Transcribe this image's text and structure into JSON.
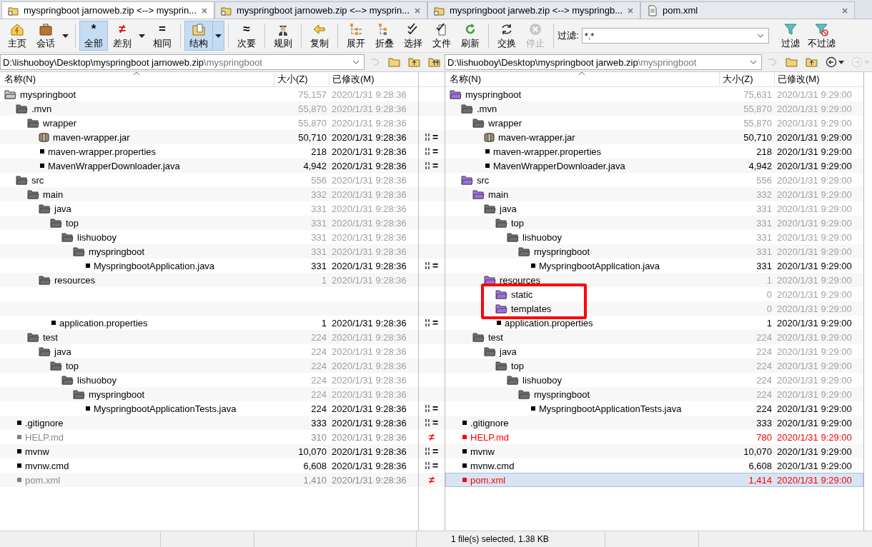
{
  "tabs": [
    {
      "kind": "folder",
      "label": "myspringboot jarnoweb.zip <--> mysprin...",
      "selected": true
    },
    {
      "kind": "folder",
      "label": "myspringboot jarnoweb.zip <--> mysprin...",
      "selected": false
    },
    {
      "kind": "folder",
      "label": "myspringboot jarweb.zip <--> myspringb...",
      "selected": false
    },
    {
      "kind": "file",
      "label": "pom.xml",
      "selected": false
    }
  ],
  "toolbar": [
    {
      "kind": "home",
      "label": "主页",
      "selected": false,
      "disabled": false
    },
    {
      "kind": "session",
      "label": "会话",
      "selected": false,
      "disabled": false,
      "dropdown": true
    },
    {
      "kind": "separator"
    },
    {
      "kind": "glyph",
      "glyph": "*",
      "color": "#000000",
      "label": "全部",
      "selected": true,
      "disabled": false
    },
    {
      "kind": "glyph",
      "glyph": "≠",
      "color": "#e00000",
      "label": "差别",
      "selected": false,
      "disabled": false,
      "dropdown": true
    },
    {
      "kind": "glyph",
      "glyph": "=",
      "color": "#000000",
      "label": "相同",
      "selected": false,
      "disabled": false
    },
    {
      "kind": "separator"
    },
    {
      "kind": "structure",
      "label": "结构",
      "selected": true,
      "disabled": false,
      "dropdown": true
    },
    {
      "kind": "separator"
    },
    {
      "kind": "glyph",
      "glyph": "≈",
      "color": "#000000",
      "label": "次要",
      "selected": false,
      "disabled": false
    },
    {
      "kind": "separator"
    },
    {
      "kind": "rules",
      "label": "规则",
      "selected": false,
      "disabled": false
    },
    {
      "kind": "separator"
    },
    {
      "kind": "copy",
      "label": "复制",
      "selected": false,
      "disabled": false
    },
    {
      "kind": "separator"
    },
    {
      "kind": "expand",
      "label": "展开",
      "selected": false,
      "disabled": false
    },
    {
      "kind": "collapse",
      "label": "折叠",
      "selected": false,
      "disabled": false
    },
    {
      "kind": "select",
      "label": "选择",
      "selected": false,
      "disabled": false
    },
    {
      "kind": "files",
      "label": "文件",
      "selected": false,
      "disabled": false
    },
    {
      "kind": "refresh",
      "label": "刷新",
      "selected": false,
      "disabled": false
    },
    {
      "kind": "separator"
    },
    {
      "kind": "swap",
      "label": "交换",
      "selected": false,
      "disabled": false
    },
    {
      "kind": "stop",
      "label": "停止",
      "selected": false,
      "disabled": true
    },
    {
      "kind": "separator"
    },
    {
      "kind": "filter-field",
      "label": "过滤:",
      "value": "*.*"
    },
    {
      "kind": "filter",
      "label": "过滤",
      "selected": false,
      "disabled": false
    },
    {
      "kind": "nofilter",
      "label": "不过滤",
      "selected": false,
      "disabled": false
    }
  ],
  "panes": {
    "left": {
      "path": "D:\\lishuoboy\\Desktop\\myspringboot jarnoweb.zip",
      "subpath": "\\myspringboot",
      "columns": [
        "名称(N)",
        "大小(Z)",
        "已修改(M)"
      ],
      "buttons": [
        {
          "kind": "sync",
          "disabled": true
        },
        {
          "kind": "folder",
          "disabled": false
        },
        {
          "kind": "up-folder",
          "disabled": false
        },
        {
          "kind": "up-both",
          "disabled": false
        }
      ]
    },
    "right": {
      "path": "D:\\lishuoboy\\Desktop\\myspringboot jarweb.zip",
      "subpath": "\\myspringboot",
      "columns": [
        "名称(N)",
        "大小(Z)",
        "已修改(M)"
      ],
      "buttons": [
        {
          "kind": "sync",
          "disabled": true
        },
        {
          "kind": "folder",
          "disabled": false
        },
        {
          "kind": "up-folder",
          "disabled": false
        },
        {
          "kind": "back",
          "disabled": false,
          "dropdown": true
        },
        {
          "kind": "forward",
          "disabled": true,
          "dropdown": true
        }
      ]
    }
  },
  "tree": {
    "nodes": [
      {
        "kind": "folder",
        "left": {
          "name": "myspringboot",
          "size": "75,157",
          "date": "2020/1/31 9:28:36",
          "kind": "summary",
          "color": "#c8c8c8",
          "selected": false
        },
        "right": {
          "name": "myspringboot",
          "size": "75,631",
          "date": "2020/1/31 9:29:00",
          "kind": "summary",
          "color": "#a46ee6",
          "selected": false
        },
        "children": [
          {
            "kind": "folder",
            "left": {
              "name": ".mvn",
              "size": "55,870",
              "date": "2020/1/31 9:28:36",
              "kind": "summary",
              "color": "#6e6e6e",
              "selected": false
            },
            "right": {
              "name": ".mvn",
              "size": "55,870",
              "date": "2020/1/31 9:29:00",
              "kind": "summary",
              "color": "#6e6e6e",
              "selected": false
            },
            "children": [
              {
                "kind": "folder",
                "left": {
                  "name": "wrapper",
                  "size": "55,870",
                  "date": "2020/1/31 9:28:36",
                  "kind": "summary",
                  "color": "#6e6e6e",
                  "selected": false
                },
                "right": {
                  "name": "wrapper",
                  "size": "55,870",
                  "date": "2020/1/31 9:29:00",
                  "kind": "summary",
                  "color": "#6e6e6e",
                  "selected": false
                },
                "children": [
                  {
                    "kind": "archive",
                    "compare": {
                      "kind": "same",
                      "glyph": "="
                    },
                    "left": {
                      "name": "maven-wrapper.jar",
                      "size": "50,710",
                      "date": "2020/1/31 9:28:36",
                      "kind": "same",
                      "selected": false
                    },
                    "right": {
                      "name": "maven-wrapper.jar",
                      "size": "50,710",
                      "date": "2020/1/31 9:29:00",
                      "kind": "same",
                      "selected": false
                    }
                  },
                  {
                    "kind": "file",
                    "compare": {
                      "kind": "same",
                      "glyph": "="
                    },
                    "left": {
                      "name": "maven-wrapper.properties",
                      "size": "218",
                      "date": "2020/1/31 9:28:36",
                      "kind": "same",
                      "selected": false
                    },
                    "right": {
                      "name": "maven-wrapper.properties",
                      "size": "218",
                      "date": "2020/1/31 9:29:00",
                      "kind": "same",
                      "selected": false
                    }
                  },
                  {
                    "kind": "file",
                    "compare": {
                      "kind": "same",
                      "glyph": "="
                    },
                    "left": {
                      "name": "MavenWrapperDownloader.java",
                      "size": "4,942",
                      "date": "2020/1/31 9:28:36",
                      "kind": "same",
                      "selected": false
                    },
                    "right": {
                      "name": "MavenWrapperDownloader.java",
                      "size": "4,942",
                      "date": "2020/1/31 9:29:00",
                      "kind": "same",
                      "selected": false
                    }
                  }
                ]
              }
            ]
          },
          {
            "kind": "folder",
            "left": {
              "name": "src",
              "size": "556",
              "date": "2020/1/31 9:28:36",
              "kind": "summary",
              "color": "#6e6e6e",
              "selected": false
            },
            "right": {
              "name": "src",
              "size": "556",
              "date": "2020/1/31 9:29:00",
              "kind": "summary",
              "color": "#a46ee6",
              "selected": false
            },
            "children": [
              {
                "kind": "folder",
                "left": {
                  "name": "main",
                  "size": "332",
                  "date": "2020/1/31 9:28:36",
                  "kind": "summary",
                  "color": "#6e6e6e",
                  "selected": false
                },
                "right": {
                  "name": "main",
                  "size": "332",
                  "date": "2020/1/31 9:29:00",
                  "kind": "summary",
                  "color": "#a46ee6",
                  "selected": false
                },
                "children": [
                  {
                    "kind": "folder",
                    "left": {
                      "name": "java",
                      "size": "331",
                      "date": "2020/1/31 9:28:36",
                      "kind": "summary",
                      "color": "#6e6e6e",
                      "selected": false
                    },
                    "right": {
                      "name": "java",
                      "size": "331",
                      "date": "2020/1/31 9:29:00",
                      "kind": "summary",
                      "color": "#6e6e6e",
                      "selected": false
                    },
                    "children": [
                      {
                        "kind": "folder",
                        "left": {
                          "name": "top",
                          "size": "331",
                          "date": "2020/1/31 9:28:36",
                          "kind": "summary",
                          "color": "#6e6e6e",
                          "selected": false
                        },
                        "right": {
                          "name": "top",
                          "size": "331",
                          "date": "2020/1/31 9:29:00",
                          "kind": "summary",
                          "color": "#6e6e6e",
                          "selected": false
                        },
                        "children": [
                          {
                            "kind": "folder",
                            "left": {
                              "name": "lishuoboy",
                              "size": "331",
                              "date": "2020/1/31 9:28:36",
                              "kind": "summary",
                              "color": "#6e6e6e",
                              "selected": false
                            },
                            "right": {
                              "name": "lishuoboy",
                              "size": "331",
                              "date": "2020/1/31 9:29:00",
                              "kind": "summary",
                              "color": "#6e6e6e",
                              "selected": false
                            },
                            "children": [
                              {
                                "kind": "folder",
                                "left": {
                                  "name": "myspringboot",
                                  "size": "331",
                                  "date": "2020/1/31 9:28:36",
                                  "kind": "summary",
                                  "color": "#6e6e6e",
                                  "selected": false
                                },
                                "right": {
                                  "name": "myspringboot",
                                  "size": "331",
                                  "date": "2020/1/31 9:29:00",
                                  "kind": "summary",
                                  "color": "#6e6e6e",
                                  "selected": false
                                },
                                "children": [
                                  {
                                    "kind": "file",
                                    "compare": {
                                      "kind": "same",
                                      "glyph": "="
                                    },
                                    "left": {
                                      "name": "MyspringbootApplication.java",
                                      "size": "331",
                                      "date": "2020/1/31 9:28:36",
                                      "kind": "same",
                                      "selected": false
                                    },
                                    "right": {
                                      "name": "MyspringbootApplication.java",
                                      "size": "331",
                                      "date": "2020/1/31 9:29:00",
                                      "kind": "same",
                                      "selected": false
                                    }
                                  }
                                ]
                              }
                            ]
                          }
                        ]
                      }
                    ]
                  },
                  {
                    "kind": "folder",
                    "left": {
                      "name": "resources",
                      "size": "1",
                      "date": "2020/1/31 9:28:36",
                      "kind": "summary",
                      "color": "#6e6e6e",
                      "selected": false
                    },
                    "right": {
                      "name": "resources",
                      "size": "1",
                      "date": "2020/1/31 9:29:00",
                      "kind": "summary",
                      "color": "#a46ee6",
                      "selected": false
                    },
                    "children": [
                      {
                        "kind": "folder",
                        "right": {
                          "name": "static",
                          "size": "0",
                          "date": "2020/1/31 9:29:00",
                          "kind": "summary",
                          "color": "#a46ee6",
                          "selected": false,
                          "boxed": true
                        }
                      },
                      {
                        "kind": "folder",
                        "right": {
                          "name": "templates",
                          "size": "0",
                          "date": "2020/1/31 9:29:00",
                          "kind": "summary",
                          "color": "#a46ee6",
                          "selected": false,
                          "boxed": true
                        }
                      },
                      {
                        "kind": "file",
                        "compare": {
                          "kind": "same",
                          "glyph": "="
                        },
                        "left": {
                          "name": "application.properties",
                          "size": "1",
                          "date": "2020/1/31 9:28:36",
                          "kind": "same",
                          "selected": false
                        },
                        "right": {
                          "name": "application.properties",
                          "size": "1",
                          "date": "2020/1/31 9:29:00",
                          "kind": "same",
                          "selected": false
                        }
                      }
                    ]
                  }
                ]
              },
              {
                "kind": "folder",
                "left": {
                  "name": "test",
                  "size": "224",
                  "date": "2020/1/31 9:28:36",
                  "kind": "summary",
                  "color": "#6e6e6e",
                  "selected": false
                },
                "right": {
                  "name": "test",
                  "size": "224",
                  "date": "2020/1/31 9:29:00",
                  "kind": "summary",
                  "color": "#6e6e6e",
                  "selected": false
                },
                "children": [
                  {
                    "kind": "folder",
                    "left": {
                      "name": "java",
                      "size": "224",
                      "date": "2020/1/31 9:28:36",
                      "kind": "summary",
                      "color": "#6e6e6e",
                      "selected": false
                    },
                    "right": {
                      "name": "java",
                      "size": "224",
                      "date": "2020/1/31 9:29:00",
                      "kind": "summary",
                      "color": "#6e6e6e",
                      "selected": false
                    },
                    "children": [
                      {
                        "kind": "folder",
                        "left": {
                          "name": "top",
                          "size": "224",
                          "date": "2020/1/31 9:28:36",
                          "kind": "summary",
                          "color": "#6e6e6e",
                          "selected": false
                        },
                        "right": {
                          "name": "top",
                          "size": "224",
                          "date": "2020/1/31 9:29:00",
                          "kind": "summary",
                          "color": "#6e6e6e",
                          "selected": false
                        },
                        "children": [
                          {
                            "kind": "folder",
                            "left": {
                              "name": "lishuoboy",
                              "size": "224",
                              "date": "2020/1/31 9:28:36",
                              "kind": "summary",
                              "color": "#6e6e6e",
                              "selected": false
                            },
                            "right": {
                              "name": "lishuoboy",
                              "size": "224",
                              "date": "2020/1/31 9:29:00",
                              "kind": "summary",
                              "color": "#6e6e6e",
                              "selected": false
                            },
                            "children": [
                              {
                                "kind": "folder",
                                "left": {
                                  "name": "myspringboot",
                                  "size": "224",
                                  "date": "2020/1/31 9:28:36",
                                  "kind": "summary",
                                  "color": "#6e6e6e",
                                  "selected": false
                                },
                                "right": {
                                  "name": "myspringboot",
                                  "size": "224",
                                  "date": "2020/1/31 9:29:00",
                                  "kind": "summary",
                                  "color": "#6e6e6e",
                                  "selected": false
                                },
                                "children": [
                                  {
                                    "kind": "file",
                                    "compare": {
                                      "kind": "same",
                                      "glyph": "="
                                    },
                                    "left": {
                                      "name": "MyspringbootApplicationTests.java",
                                      "size": "224",
                                      "date": "2020/1/31 9:28:36",
                                      "kind": "same",
                                      "selected": false
                                    },
                                    "right": {
                                      "name": "MyspringbootApplicationTests.java",
                                      "size": "224",
                                      "date": "2020/1/31 9:29:00",
                                      "kind": "same",
                                      "selected": false
                                    }
                                  }
                                ]
                              }
                            ]
                          }
                        ]
                      }
                    ]
                  }
                ]
              }
            ]
          },
          {
            "kind": "file",
            "compare": {
              "kind": "same",
              "glyph": "="
            },
            "left": {
              "name": ".gitignore",
              "size": "333",
              "date": "2020/1/31 9:28:36",
              "kind": "same",
              "selected": false
            },
            "right": {
              "name": ".gitignore",
              "size": "333",
              "date": "2020/1/31 9:29:00",
              "kind": "same",
              "selected": false
            }
          },
          {
            "kind": "file",
            "compare": {
              "kind": "diff",
              "glyph": "≠"
            },
            "left": {
              "name": "HELP.md",
              "size": "310",
              "date": "2020/1/31 9:28:36",
              "kind": "older",
              "selected": false
            },
            "right": {
              "name": "HELP.md",
              "size": "780",
              "date": "2020/1/31 9:29:00",
              "kind": "newer",
              "selected": false
            }
          },
          {
            "kind": "file",
            "compare": {
              "kind": "same",
              "glyph": "="
            },
            "left": {
              "name": "mvnw",
              "size": "10,070",
              "date": "2020/1/31 9:28:36",
              "kind": "same",
              "selected": false
            },
            "right": {
              "name": "mvnw",
              "size": "10,070",
              "date": "2020/1/31 9:29:00",
              "kind": "same",
              "selected": false
            }
          },
          {
            "kind": "file",
            "compare": {
              "kind": "same",
              "glyph": "="
            },
            "left": {
              "name": "mvnw.cmd",
              "size": "6,608",
              "date": "2020/1/31 9:28:36",
              "kind": "same",
              "selected": false
            },
            "right": {
              "name": "mvnw.cmd",
              "size": "6,608",
              "date": "2020/1/31 9:29:00",
              "kind": "same",
              "selected": false
            }
          },
          {
            "kind": "file",
            "compare": {
              "kind": "diff",
              "glyph": "≠"
            },
            "left": {
              "name": "pom.xml",
              "size": "1,410",
              "date": "2020/1/31 9:28:36",
              "kind": "older",
              "selected": false
            },
            "right": {
              "name": "pom.xml",
              "size": "1,414",
              "date": "2020/1/31 9:29:00",
              "kind": "newer",
              "selected": true
            }
          }
        ]
      }
    ]
  },
  "status_bar": {
    "text": "1 file(s) selected, 1.38 KB"
  }
}
